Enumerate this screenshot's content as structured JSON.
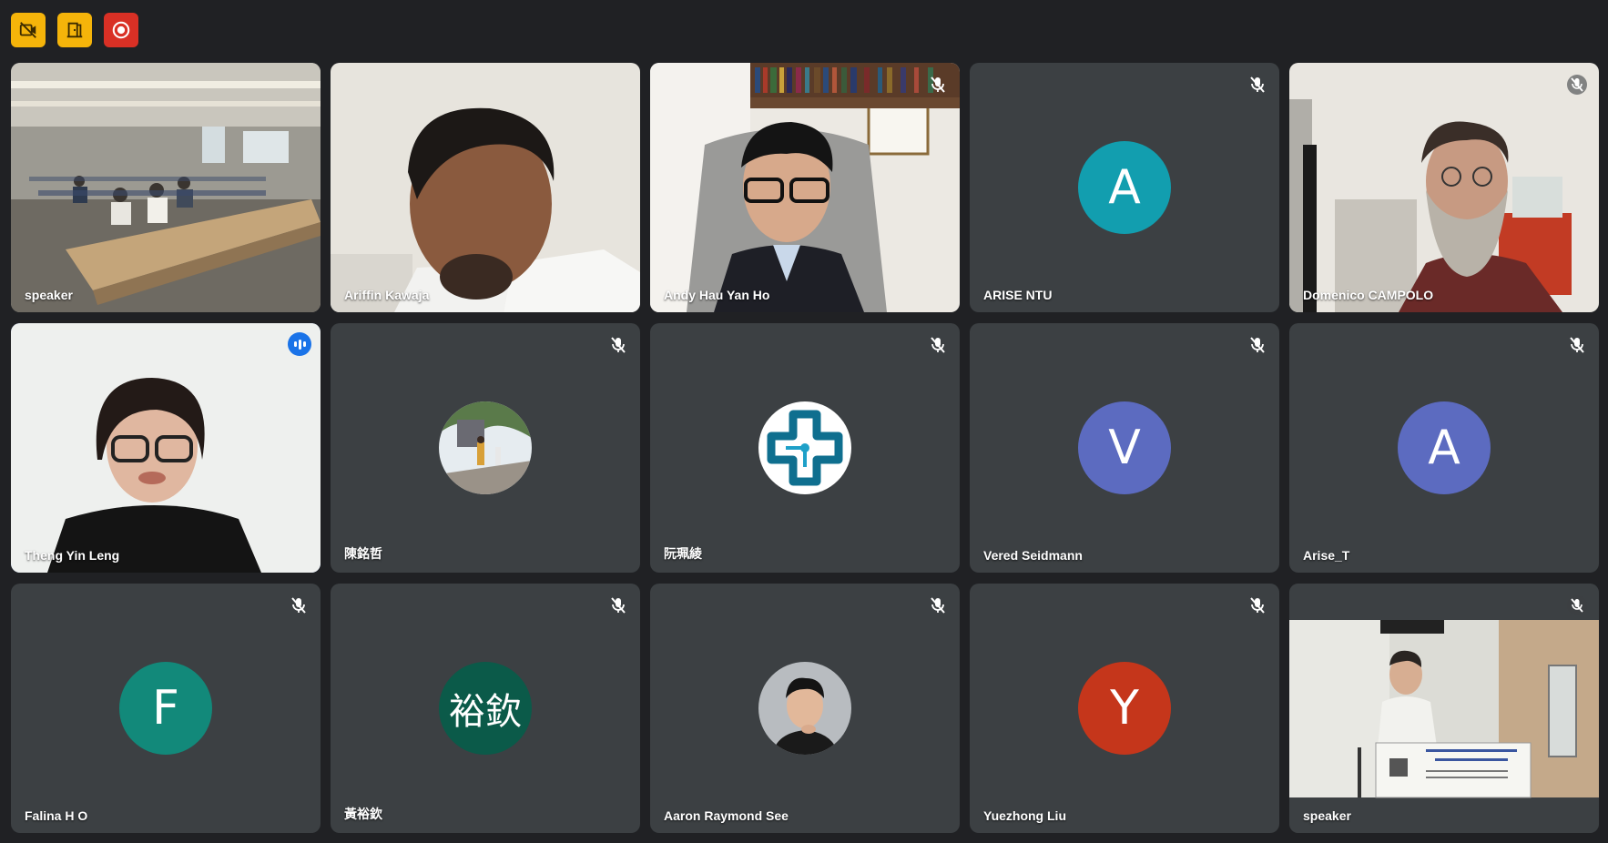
{
  "toolbar": {
    "icons": [
      "no-video-icon",
      "door-icon",
      "record-icon"
    ]
  },
  "colors": {
    "tile_bg": "#3c4043",
    "page_bg": "#202124",
    "active_border": "#8ab4f8",
    "speaking": "#1a73e8"
  },
  "tiles": [
    {
      "name": "speaker"
    },
    {
      "name": "Ariffin Kawaja"
    },
    {
      "name": "Andy Hau Yan Ho"
    },
    {
      "name": "ARISE NTU",
      "initial": "A",
      "color": "#129eaf"
    },
    {
      "name": "Domenico CAMPOLO"
    },
    {
      "name": "Theng Yin Leng"
    },
    {
      "name": "陳銘哲"
    },
    {
      "name": "阮珮綾"
    },
    {
      "name": "Vered Seidmann",
      "initial": "V",
      "color": "#5c6bc0"
    },
    {
      "name": "Arise_T",
      "initial": "A",
      "color": "#5c6bc0"
    },
    {
      "name": "Falina H O",
      "initial": "F",
      "color": "#12897a"
    },
    {
      "name": "黃裕欽",
      "initial": "裕欽",
      "color": "#0b5a49"
    },
    {
      "name": "Aaron Raymond See"
    },
    {
      "name": "Yuezhong Liu",
      "initial": "Y",
      "color": "#c5361b"
    },
    {
      "name": "speaker"
    }
  ]
}
